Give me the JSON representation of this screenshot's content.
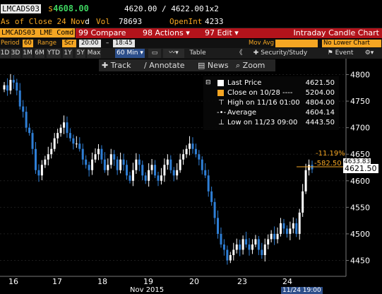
{
  "header": {
    "ticker": "LMCADS03",
    "price_prefix": "s",
    "price": "4608.00",
    "bid_ask": "4620.00 / 4622.00",
    "size": "1x2",
    "asof": "As of Close 24 Nov",
    "asof_suffix": "d",
    "vol_label": "Vol",
    "vol_value": "78693",
    "openint_label": "OpenInt",
    "openint_value": "4233"
  },
  "menubar": {
    "security": "LMCADS03 LME Comd",
    "compare": "99 Compare",
    "actions": "98 Actions",
    "edit": "97 Edit",
    "title": "Intraday Candle Chart"
  },
  "settings": {
    "period_label": "Period",
    "period_value": "60",
    "range_label": "Range",
    "range_value": "Scr",
    "time_from": "20:00",
    "time_to": "18:45",
    "study1": "Mov Avg",
    "study2": "No Lower Chart"
  },
  "toolbar": {
    "ranges": [
      "1D",
      "3D",
      "1M",
      "6M",
      "YTD",
      "1Y",
      "5Y",
      "Max"
    ],
    "interval": "60 Min",
    "table": "Table",
    "security_study": "Security/Study",
    "event": "Event"
  },
  "tools": {
    "track": "Track",
    "annotate": "Annotate",
    "news": "News",
    "zoom": "Zoom"
  },
  "legend": [
    {
      "label": "Last Price",
      "value": "4621.50"
    },
    {
      "label": "Close on 10/28 ----",
      "value": "5204.00"
    },
    {
      "label": "High on 11/16 01:00",
      "value": "4804.00"
    },
    {
      "label": "Average",
      "value": "4604.14"
    },
    {
      "label": "Low on 11/23 09:00",
      "value": "4443.50"
    }
  ],
  "annotations": {
    "pct_change": "-11.19%",
    "abs_change": "-582.50",
    "avg_tag": "4633.83",
    "last_tag": "4621.50",
    "cursor_time": "11/24 19:00"
  },
  "colors": {
    "up": "#ffffff",
    "down": "#2f7fd6",
    "accent": "#f5a623",
    "red": "#b3131b"
  },
  "chart_data": {
    "type": "candlestick",
    "title": "Intraday Candle Chart",
    "ylim": [
      4420,
      4830
    ],
    "y_ticks": [
      "4800",
      "4750",
      "4700",
      "4650",
      "4600",
      "4550",
      "4500",
      "4450"
    ],
    "x_ticks": [
      "16",
      "17",
      "18",
      "19",
      "20",
      "23",
      "24"
    ],
    "x_label": "Nov 2015",
    "series": [
      {
        "name": "LMCADS03",
        "interval": "60 Min",
        "close": [
          4780,
          4770,
          4790,
          4785,
          4770,
          4740,
          4730,
          4700,
          4690,
          4660,
          4620,
          4610,
          4630,
          4640,
          4650,
          4660,
          4680,
          4690,
          4700,
          4710,
          4690,
          4680,
          4670,
          4670,
          4660,
          4640,
          4630,
          4620,
          4640,
          4650,
          4660,
          4640,
          4620,
          4630,
          4650,
          4640,
          4620,
          4640,
          4630,
          4610,
          4600,
          4620,
          4640,
          4630,
          4610,
          4600,
          4620,
          4630,
          4610,
          4600,
          4610,
          4630,
          4640,
          4620,
          4610,
          4620,
          4640,
          4650,
          4660,
          4670,
          4660,
          4650,
          4640,
          4620,
          4610,
          4580,
          4560,
          4530,
          4500,
          4480,
          4470,
          4450,
          4460,
          4470,
          4480,
          4470,
          4490,
          4480,
          4470,
          4480,
          4490,
          4470,
          4460,
          4480,
          4490,
          4500,
          4490,
          4500,
          4520,
          4510,
          4500,
          4510,
          4520,
          4500,
          4540,
          4580,
          4620,
          4630,
          4621.5
        ]
      }
    ],
    "last_price": 4621.5,
    "high": 4804.0,
    "low": 4443.5,
    "average": 4604.14,
    "close_ref": 5204.0
  }
}
